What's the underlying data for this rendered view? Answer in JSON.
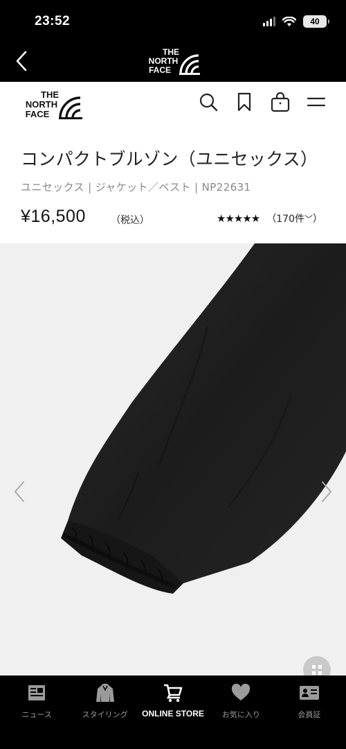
{
  "status_bar": {
    "time": "23:52",
    "battery": "40"
  },
  "brand": {
    "logo_lines": [
      "THE",
      "NORTH",
      "FACE"
    ]
  },
  "header": {
    "icons": [
      "search-icon",
      "bookmark-icon",
      "bag-icon",
      "menu-icon"
    ]
  },
  "product": {
    "title": "コンパクトブルゾン（ユニセックス）",
    "meta": "ユニセックス | ジャケット／ベスト | NP22631",
    "price": "¥16,500",
    "tax_note": "（税込）",
    "rating_stars": "★★★★★",
    "rating_value": 5,
    "review_count": "（170件",
    "review_chevron": "﹀"
  },
  "carousel": {
    "prev_icon": "chevron-left-icon",
    "next_icon": "chevron-right-icon"
  },
  "tabbar": {
    "items": [
      {
        "label": "ニュース",
        "icon": "news-icon"
      },
      {
        "label": "スタイリング",
        "icon": "hoodie-icon"
      },
      {
        "label": "ONLINE STORE",
        "icon": "cart-icon"
      },
      {
        "label": "お気に入り",
        "icon": "heart-icon"
      },
      {
        "label": "会員証",
        "icon": "member-card-icon"
      }
    ],
    "active_index": 2
  },
  "colors": {
    "bar_bg": "#000000",
    "tab_inactive": "#9b9b9b",
    "tab_active": "#ffffff",
    "image_bg": "#f0f0f0"
  }
}
